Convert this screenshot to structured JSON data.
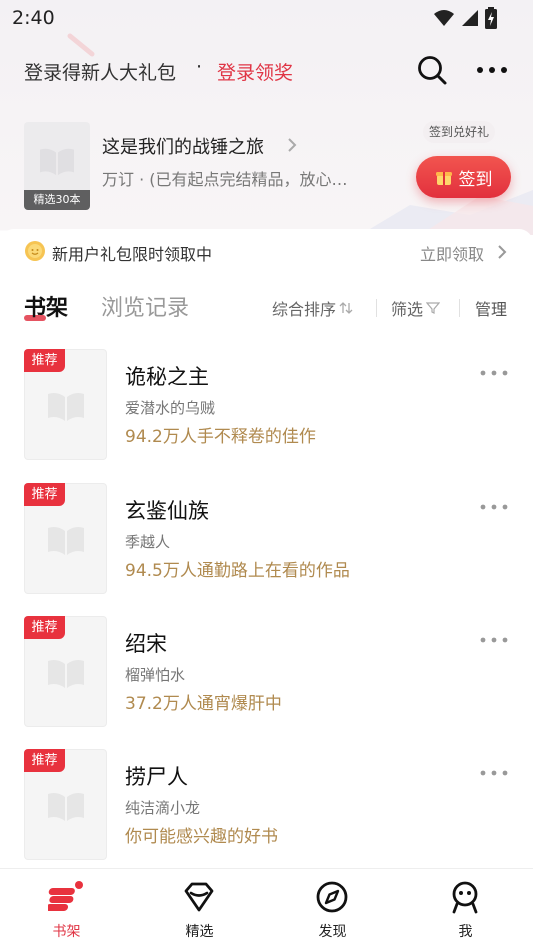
{
  "status_bar": {
    "time": "2:40"
  },
  "top_bar": {
    "login_prompt": "登录得新人大礼包",
    "separator": "·",
    "login_link": "登录领奖"
  },
  "featured": {
    "cover_tag": "精选30本",
    "title": "这是我们的战锤之旅",
    "subtitle": "万订 · (已有起点完结精品，放心…",
    "checkin_hint": "签到兑好礼",
    "checkin_button": "签到"
  },
  "gift_banner": {
    "text": "新用户礼包限时领取中",
    "action": "立即领取"
  },
  "tabs": {
    "shelf": "书架",
    "history": "浏览记录",
    "sort": "综合排序",
    "filter": "筛选",
    "manage": "管理"
  },
  "books": [
    {
      "badge": "推荐",
      "title": "诡秘之主",
      "author": "爱潜水的乌贼",
      "blurb": "94.2万人手不释卷的佳作"
    },
    {
      "badge": "推荐",
      "title": "玄鉴仙族",
      "author": "季越人",
      "blurb": "94.5万人通勤路上在看的作品"
    },
    {
      "badge": "推荐",
      "title": "绍宋",
      "author": "榴弹怕水",
      "blurb": "37.2万人通宵爆肝中"
    },
    {
      "badge": "推荐",
      "title": "捞尸人",
      "author": "纯洁滴小龙",
      "blurb": "你可能感兴趣的好书"
    }
  ],
  "bottom_nav": [
    {
      "label": "书架",
      "icon": "bookshelf-icon",
      "active": true
    },
    {
      "label": "精选",
      "icon": "gem-icon",
      "active": false
    },
    {
      "label": "发现",
      "icon": "compass-icon",
      "active": false
    },
    {
      "label": "我",
      "icon": "profile-face-icon",
      "active": false
    }
  ],
  "colors": {
    "accent": "#e03545",
    "blurb": "#b08a4f",
    "muted": "#777777"
  }
}
